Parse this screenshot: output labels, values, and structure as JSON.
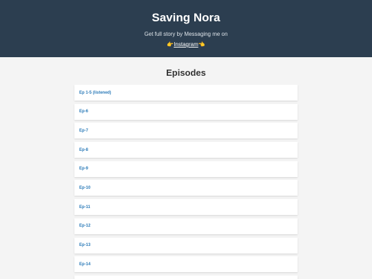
{
  "header": {
    "title": "Saving Nora",
    "subtitle": "Get full story by Messaging me on",
    "emoji_left": "👉",
    "instagram_label": "Instagram",
    "emoji_right": "👈"
  },
  "main": {
    "section_title": "Episodes",
    "episodes": [
      {
        "label": "Ep 1-5 (listened)"
      },
      {
        "label": "Ep-6"
      },
      {
        "label": "Ep-7"
      },
      {
        "label": "Ep-8"
      },
      {
        "label": "Ep-9"
      },
      {
        "label": "Ep-10"
      },
      {
        "label": "Ep-11"
      },
      {
        "label": "Ep-12"
      },
      {
        "label": "Ep-13"
      },
      {
        "label": "Ep-14"
      },
      {
        "label": ""
      }
    ]
  },
  "colors": {
    "header_bg": "#2c3e50",
    "page_bg": "#f4f4f4",
    "link": "#2a7ab8"
  }
}
